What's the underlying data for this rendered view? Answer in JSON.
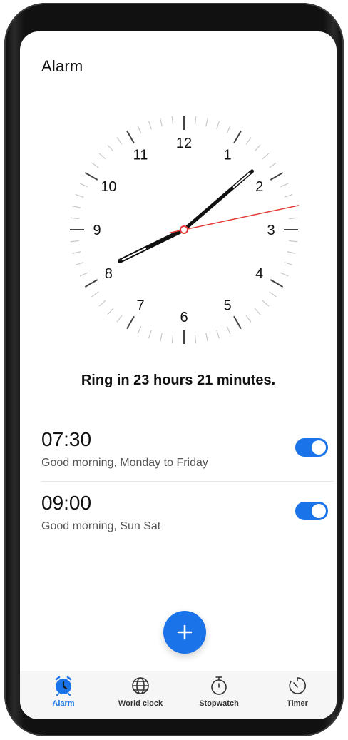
{
  "colors": {
    "accent": "#1a73e8",
    "second_hand": "#e53935"
  },
  "header": {
    "title": "Alarm"
  },
  "clock": {
    "numbers": [
      "12",
      "1",
      "2",
      "3",
      "4",
      "5",
      "6",
      "7",
      "8",
      "9",
      "10",
      "11"
    ],
    "time": {
      "hour": 8,
      "minute": 8,
      "second": 13
    }
  },
  "ring_text": "Ring in 23 hours 21 minutes.",
  "alarms": [
    {
      "time": "07:30",
      "label": "Good morning, Monday to Friday",
      "enabled": true
    },
    {
      "time": "09:00",
      "label": "Good morning, Sun Sat",
      "enabled": true
    }
  ],
  "fab": {
    "icon": "plus-icon"
  },
  "tabs": [
    {
      "label": "Alarm",
      "icon": "alarm-clock-icon",
      "active": true
    },
    {
      "label": "World clock",
      "icon": "globe-icon",
      "active": false
    },
    {
      "label": "Stopwatch",
      "icon": "stopwatch-icon",
      "active": false
    },
    {
      "label": "Timer",
      "icon": "timer-icon",
      "active": false
    }
  ]
}
